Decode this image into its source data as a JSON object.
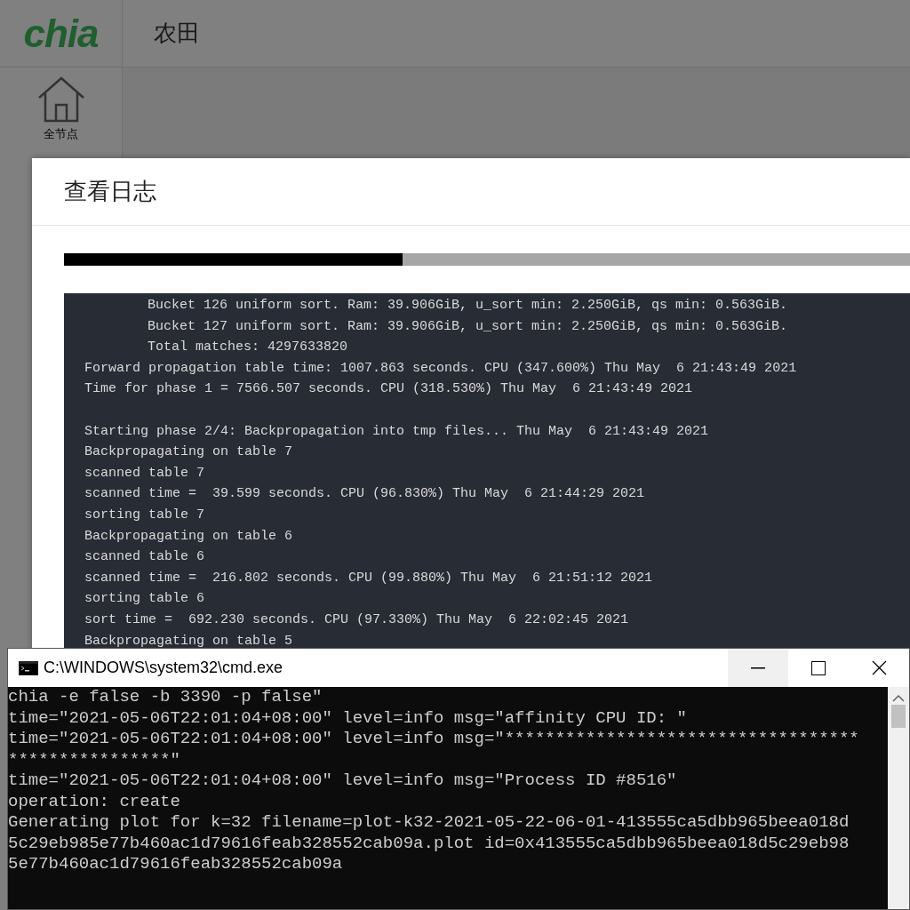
{
  "app": {
    "logo": "chia",
    "header_title": "农田",
    "sidebar": {
      "items": [
        {
          "label": "全节点"
        }
      ]
    }
  },
  "dialog": {
    "title": "查看日志",
    "progress": {
      "level": 0.4
    },
    "log_lines": [
      {
        "text": "Bucket 126 uniform sort. Ram: 39.906GiB, u_sort min: 2.250GiB, qs min: 0.563GiB.",
        "indented": true,
        "gap_before": false
      },
      {
        "text": "Bucket 127 uniform sort. Ram: 39.906GiB, u_sort min: 2.250GiB, qs min: 0.563GiB.",
        "indented": true,
        "gap_before": false
      },
      {
        "text": "Total matches: 4297633820",
        "indented": true,
        "gap_before": false
      },
      {
        "text": "Forward propagation table time: 1007.863 seconds. CPU (347.600%) Thu May  6 21:43:49 2021",
        "indented": false,
        "gap_before": false
      },
      {
        "text": "Time for phase 1 = 7566.507 seconds. CPU (318.530%) Thu May  6 21:43:49 2021",
        "indented": false,
        "gap_before": false
      },
      {
        "text": "Starting phase 2/4: Backpropagation into tmp files... Thu May  6 21:43:49 2021",
        "indented": false,
        "gap_before": true
      },
      {
        "text": "Backpropagating on table 7",
        "indented": false,
        "gap_before": false
      },
      {
        "text": "scanned table 7",
        "indented": false,
        "gap_before": false
      },
      {
        "text": "scanned time =  39.599 seconds. CPU (96.830%) Thu May  6 21:44:29 2021",
        "indented": false,
        "gap_before": false
      },
      {
        "text": "sorting table 7",
        "indented": false,
        "gap_before": false
      },
      {
        "text": "Backpropagating on table 6",
        "indented": false,
        "gap_before": false
      },
      {
        "text": "scanned table 6",
        "indented": false,
        "gap_before": false
      },
      {
        "text": "scanned time =  216.802 seconds. CPU (99.880%) Thu May  6 21:51:12 2021",
        "indented": false,
        "gap_before": false
      },
      {
        "text": "sorting table 6",
        "indented": false,
        "gap_before": false
      },
      {
        "text": "sort time =  692.230 seconds. CPU (97.330%) Thu May  6 22:02:45 2021",
        "indented": false,
        "gap_before": false
      },
      {
        "text": "Backpropagating on table 5",
        "indented": false,
        "gap_before": false
      }
    ]
  },
  "console": {
    "title": "C:\\WINDOWS\\system32\\cmd.exe",
    "lines": [
      "chia -e false -b 3390 -p false\"",
      "time=\"2021-05-06T22:01:04+08:00\" level=info msg=\"affinity CPU ID: \"",
      "time=\"2021-05-06T22:01:04+08:00\" level=info msg=\"***********************************",
      "****************\"",
      "time=\"2021-05-06T22:01:04+08:00\" level=info msg=\"Process ID #8516\"",
      "operation: create",
      "Generating plot for k=32 filename=plot-k32-2021-05-22-06-01-413555ca5dbb965beea018d",
      "5c29eb985e77b460ac1d79616feab328552cab09a.plot id=0x413555ca5dbb965beea018d5c29eb98",
      "5e77b460ac1d79616feab328552cab09a"
    ]
  }
}
